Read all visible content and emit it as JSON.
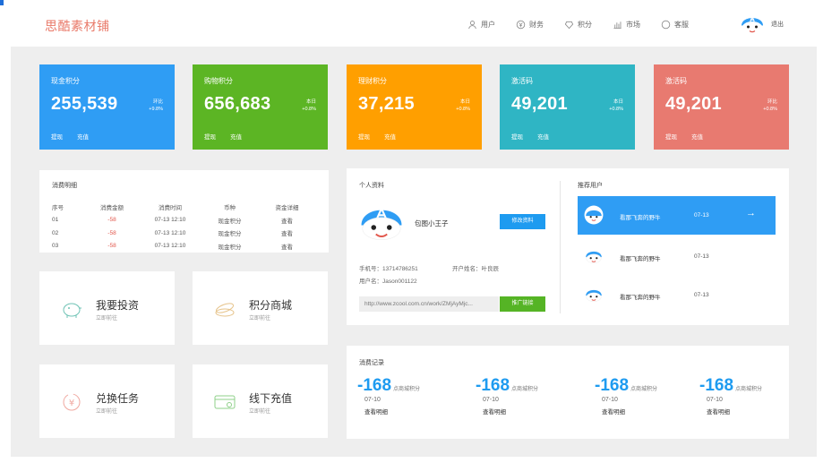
{
  "brand": {
    "name": "思酷素材铺"
  },
  "nav": [
    {
      "label": "用户",
      "icon": "user-icon"
    },
    {
      "label": "财务",
      "icon": "finance-icon"
    },
    {
      "label": "积分",
      "icon": "points-icon"
    },
    {
      "label": "市场",
      "icon": "chart-icon"
    },
    {
      "label": "客服",
      "icon": "service-icon"
    }
  ],
  "account": {
    "logout": "退出"
  },
  "stats": [
    {
      "title": "现金积分",
      "value": "255,539",
      "sub1": "环比",
      "sub2": "+9.8%",
      "link1": "提现",
      "link2": "充值",
      "color": "#2f9df4"
    },
    {
      "title": "购物积分",
      "value": "656,683",
      "sub1": "本日",
      "sub2": "+0.8%",
      "link1": "提现",
      "link2": "充值",
      "color": "#5cb524"
    },
    {
      "title": "理财积分",
      "value": "37,215",
      "sub1": "本日",
      "sub2": "+0.8%",
      "link1": "提现",
      "link2": "充值",
      "color": "#ff9f00"
    },
    {
      "title": "激活码",
      "value": "49,201",
      "sub1": "本日",
      "sub2": "+0.8%",
      "link1": "提现",
      "link2": "充值",
      "color": "#2fb5c4"
    },
    {
      "title": "激活码",
      "value": "49,201",
      "sub1": "环比",
      "sub2": "+0.8%",
      "link1": "提现",
      "link2": "充值",
      "color": "#e87a70"
    }
  ],
  "consumption_detail": {
    "title": "消费明细",
    "headers": [
      "序号",
      "消费金额",
      "消费时间",
      "币种",
      "资金详细"
    ],
    "rows": [
      [
        "01",
        "-58",
        "07-13 12:10",
        "现金积分",
        "查看"
      ],
      [
        "02",
        "-58",
        "07-13 12:10",
        "现金积分",
        "查看"
      ],
      [
        "03",
        "-58",
        "07-13 12:10",
        "现金积分",
        "查看"
      ]
    ]
  },
  "tiles": [
    {
      "title": "我要投资",
      "sub": "立即前往"
    },
    {
      "title": "积分商城",
      "sub": "立即前往"
    },
    {
      "title": "兑换任务",
      "sub": "立即前往"
    },
    {
      "title": "线下充值",
      "sub": "立即前往"
    }
  ],
  "profile": {
    "title": "个人资料",
    "name": "包图小王子",
    "edit": "修改资料",
    "phone": "手机号：13714786251",
    "bank": "开户姓名：叶良辰",
    "username": "用户名：Jason001122",
    "url": "http://www.zcool.com.cn/work/ZMjAyMjc...",
    "promote": "推广链接"
  },
  "recommend": {
    "title": "推荐用户",
    "rows": [
      {
        "name": "看那飞奔的野牛",
        "date": "07-13",
        "active": true
      },
      {
        "name": "看那飞奔的野牛",
        "date": "07-13",
        "active": false
      },
      {
        "name": "看那飞奔的野牛",
        "date": "07-13",
        "active": false
      }
    ]
  },
  "records": {
    "title": "消费记录",
    "items": [
      {
        "amount": "-168",
        "unit": "点商城积分",
        "date": "07-10",
        "more": "查看明细"
      },
      {
        "amount": "-168",
        "unit": "点商城积分",
        "date": "07-10",
        "more": "查看明细"
      },
      {
        "amount": "-168",
        "unit": "点商城积分",
        "date": "07-10",
        "more": "查看明细"
      },
      {
        "amount": "-168",
        "unit": "点商城积分",
        "date": "07-10",
        "more": "查看明细"
      }
    ]
  },
  "colors": {
    "accent": "#1e9bf0",
    "green": "#55b425",
    "brand": "#e97a6a"
  }
}
